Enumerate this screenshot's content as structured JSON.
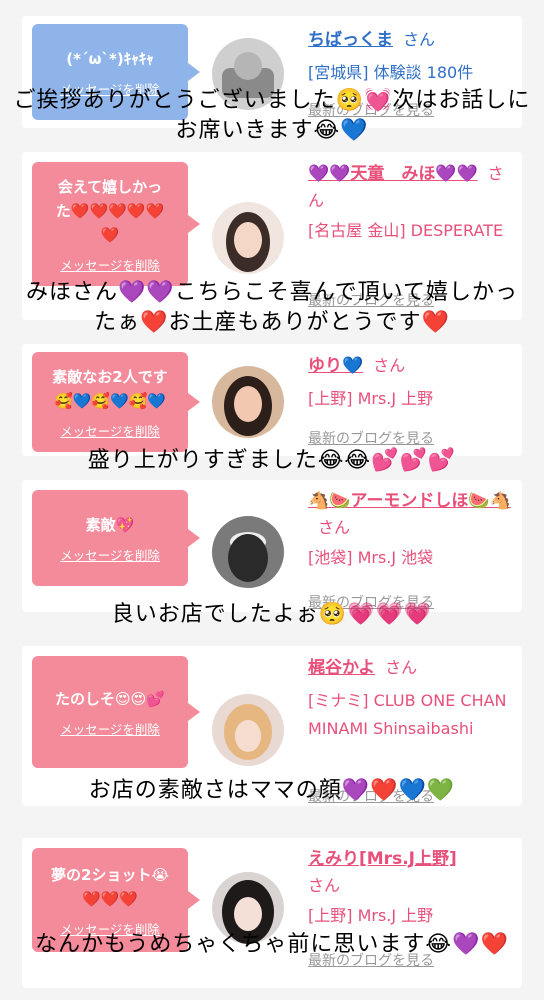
{
  "items": [
    {
      "bubble_msg": "(*´ω`*)ｷｬｷｬ",
      "bubble_delete": "メッセージを削除",
      "name": "ちばっくま",
      "san": "さん",
      "shop": "[宮城県] 体験談 180件",
      "blog": "最新のブログを見る",
      "caption": "ご挨拶ありがとうございました🥺💓次はお話しにお席いきます😂💙"
    },
    {
      "bubble_msg": "会えて嬉しかった❤️❤️❤️❤️❤️❤️",
      "bubble_delete": "メッセージを削除",
      "name": "💜💜天童　みほ💜💜",
      "san": "さん",
      "shop": "[名古屋 金山] DESPERATE",
      "blog": "最新のブログを見る",
      "caption": "みほさん💜💜こちらこそ喜んで頂いて嬉しかったぁ❤️お土産もありがとうです❤️"
    },
    {
      "bubble_msg": "素敵なお2人です🥰💙🥰💙🥰💙",
      "bubble_delete": "メッセージを削除",
      "name": "ゆり💙",
      "san": "さん",
      "shop": "[上野] Mrs.J 上野",
      "blog": "最新のブログを見る",
      "caption": "盛り上がりすぎました😂😂💕💕💕"
    },
    {
      "bubble_msg": "素敵💖",
      "bubble_delete": "メッセージを削除",
      "name": "🐴🍉アーモンドしほ🍉🐴",
      "san": "さん",
      "shop": "[池袋] Mrs.J 池袋",
      "blog": "最新のブログを見る",
      "caption": "良いお店でしたよぉ🥺💗💗💗"
    },
    {
      "bubble_msg": "たのしそ😍😍💕",
      "bubble_delete": "メッセージを削除",
      "name": "梶谷かよ",
      "san": "さん",
      "shop": "[ミナミ] CLUB ONE CHAN MINAMI Shinsaibashi",
      "blog": "最新のブログを見る",
      "caption": "お店の素敵さはママの顔💜❤️💙💚"
    },
    {
      "bubble_msg": "夢の2ショット😭❤️❤️❤️",
      "bubble_delete": "メッセージを削除",
      "name": "えみり[Mrs.J上野]",
      "san": "さん",
      "shop": "[上野] Mrs.J 上野",
      "blog": "最新のブログを見る",
      "caption": "なんかもうめちゃくちゃ前に思います😂💜❤️"
    }
  ],
  "colors": {
    "accent_pink": "#f48b9b",
    "accent_blue": "#8fb4ea",
    "name_pink": "#e8507a",
    "name_blue": "#2f6fc8"
  }
}
